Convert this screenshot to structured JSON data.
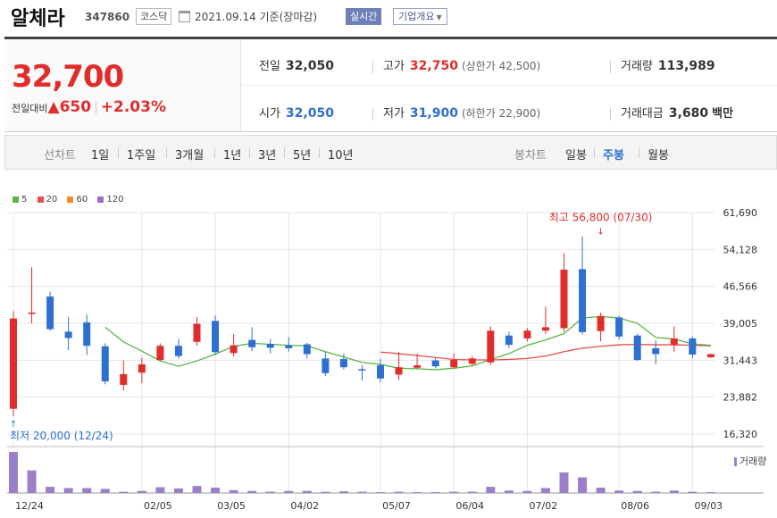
{
  "header": {
    "name": "알체라",
    "code": "347860",
    "market": "코스닥",
    "date": "2021.09.14 기준(장마감)",
    "realtime_label": "실시간",
    "company_label": "기업개요"
  },
  "price": {
    "current": "32,700",
    "change_label": "전일대비",
    "change_value": "650",
    "change_pct": "+2.03%"
  },
  "stats": {
    "prev_label": "전일",
    "prev": "32,050",
    "high_label": "고가",
    "high": "32,750",
    "upper_limit": "(상한가 42,500)",
    "volume_label": "거래량",
    "volume": "113,989",
    "open_label": "시가",
    "open": "32,050",
    "low_label": "저가",
    "low": "31,900",
    "lower_limit": "(하한가 22,900)",
    "amount_label": "거래대금",
    "amount": "3,680",
    "amount_unit": "백만"
  },
  "periods": {
    "line_label": "선차트",
    "line_items": [
      "1일",
      "1주일",
      "3개월",
      "1년",
      "3년",
      "5년",
      "10년"
    ],
    "candle_label": "봉차트",
    "candle_items": [
      "일봉",
      "주봉",
      "월봉"
    ],
    "active_candle": "주봉"
  },
  "colors": {
    "up": "#e12c2c",
    "down": "#2e6fd1",
    "ma5": "#5bb447",
    "ma20": "#e84c4c",
    "ma60": "#f28b30",
    "ma120": "#9b6fcf",
    "volume": "#9b7fc8"
  },
  "chart_data": {
    "type": "candlestick",
    "legend": [
      {
        "name": "5",
        "color": "#5bb447"
      },
      {
        "name": "20",
        "color": "#e84c4c"
      },
      {
        "name": "60",
        "color": "#f28b30"
      },
      {
        "name": "120",
        "color": "#9b6fcf"
      }
    ],
    "y_ticks": [
      "61,690",
      "54,128",
      "46,566",
      "39,005",
      "31,443",
      "23,882",
      "16,320"
    ],
    "ylim": [
      16320,
      61690
    ],
    "x_ticks": [
      {
        "label": "12/24",
        "index": 0
      },
      {
        "label": "02/05",
        "index": 7
      },
      {
        "label": "03/05",
        "index": 11
      },
      {
        "label": "04/02",
        "index": 15
      },
      {
        "label": "05/07",
        "index": 20
      },
      {
        "label": "06/04",
        "index": 24
      },
      {
        "label": "07/02",
        "index": 28
      },
      {
        "label": "08/06",
        "index": 33
      },
      {
        "label": "09/03",
        "index": 37
      }
    ],
    "annotations": {
      "high": "최고 56,800 (07/30)",
      "high_value": 56800,
      "high_index": 32,
      "low": "최저 20,000 (12/24)",
      "low_value": 20000,
      "low_index": 0
    },
    "volume_label": "거래량",
    "candles": [
      {
        "o": 21500,
        "h": 41500,
        "l": 20000,
        "c": 40000
      },
      {
        "o": 41000,
        "h": 50500,
        "l": 39000,
        "c": 41200
      },
      {
        "o": 44500,
        "h": 45500,
        "l": 37500,
        "c": 37800
      },
      {
        "o": 37300,
        "h": 40300,
        "l": 33500,
        "c": 36000
      },
      {
        "o": 39200,
        "h": 40800,
        "l": 32500,
        "c": 34400
      },
      {
        "o": 34300,
        "h": 34900,
        "l": 26500,
        "c": 27100
      },
      {
        "o": 26400,
        "h": 31400,
        "l": 25200,
        "c": 28600
      },
      {
        "o": 28900,
        "h": 31900,
        "l": 26700,
        "c": 30600
      },
      {
        "o": 31500,
        "h": 34900,
        "l": 31300,
        "c": 34400
      },
      {
        "o": 34400,
        "h": 35800,
        "l": 31800,
        "c": 32300
      },
      {
        "o": 35200,
        "h": 40300,
        "l": 34400,
        "c": 38900
      },
      {
        "o": 39500,
        "h": 40600,
        "l": 32500,
        "c": 33100
      },
      {
        "o": 32900,
        "h": 36800,
        "l": 32200,
        "c": 34500
      },
      {
        "o": 35600,
        "h": 38200,
        "l": 33300,
        "c": 34100
      },
      {
        "o": 34800,
        "h": 35800,
        "l": 32900,
        "c": 34000
      },
      {
        "o": 34500,
        "h": 36200,
        "l": 33200,
        "c": 33900
      },
      {
        "o": 34700,
        "h": 35000,
        "l": 31800,
        "c": 32700
      },
      {
        "o": 31800,
        "h": 33200,
        "l": 28200,
        "c": 28800
      },
      {
        "o": 31700,
        "h": 32800,
        "l": 29600,
        "c": 30000
      },
      {
        "o": 29600,
        "h": 30400,
        "l": 27300,
        "c": 29400
      },
      {
        "o": 30400,
        "h": 31700,
        "l": 26900,
        "c": 27700
      },
      {
        "o": 28500,
        "h": 33100,
        "l": 27400,
        "c": 30000
      },
      {
        "o": 29900,
        "h": 32800,
        "l": 29700,
        "c": 30400
      },
      {
        "o": 31400,
        "h": 31900,
        "l": 29800,
        "c": 30200
      },
      {
        "o": 30000,
        "h": 32800,
        "l": 29700,
        "c": 31500
      },
      {
        "o": 30700,
        "h": 32300,
        "l": 30300,
        "c": 31800
      },
      {
        "o": 31000,
        "h": 38400,
        "l": 30500,
        "c": 37500
      },
      {
        "o": 36500,
        "h": 37300,
        "l": 33900,
        "c": 34600
      },
      {
        "o": 35900,
        "h": 38000,
        "l": 35300,
        "c": 37500
      },
      {
        "o": 37500,
        "h": 42400,
        "l": 36800,
        "c": 38200
      },
      {
        "o": 38000,
        "h": 53400,
        "l": 37300,
        "c": 50000
      },
      {
        "o": 50100,
        "h": 56800,
        "l": 36700,
        "c": 37200
      },
      {
        "o": 37400,
        "h": 41200,
        "l": 35300,
        "c": 40500
      },
      {
        "o": 40200,
        "h": 40600,
        "l": 35700,
        "c": 36300
      },
      {
        "o": 36500,
        "h": 36900,
        "l": 31300,
        "c": 31500
      },
      {
        "o": 33900,
        "h": 35500,
        "l": 30600,
        "c": 32700
      },
      {
        "o": 34600,
        "h": 38400,
        "l": 33200,
        "c": 35900
      },
      {
        "o": 35900,
        "h": 36300,
        "l": 31800,
        "c": 32600
      },
      {
        "o": 32050,
        "h": 32750,
        "l": 31900,
        "c": 32700
      }
    ],
    "ma5": [
      null,
      null,
      null,
      null,
      null,
      38200,
      35200,
      33300,
      31300,
      30200,
      31300,
      32700,
      34300,
      34900,
      34700,
      34500,
      34400,
      33200,
      32100,
      31000,
      30600,
      29800,
      29700,
      29500,
      29800,
      30300,
      31600,
      32800,
      34500,
      35600,
      36900,
      40100,
      40400,
      40100,
      39000,
      36100,
      35800,
      34800,
      34500
    ],
    "ma20": [
      null,
      null,
      null,
      null,
      null,
      null,
      null,
      null,
      null,
      null,
      null,
      null,
      null,
      null,
      null,
      null,
      null,
      null,
      null,
      null,
      33100,
      32800,
      32400,
      32000,
      31600,
      31500,
      31500,
      31600,
      31800,
      32300,
      33200,
      33900,
      34300,
      34600,
      34700,
      34600,
      34600,
      34500,
      34400
    ],
    "volumes": [
      100,
      55,
      15,
      12,
      12,
      10,
      3,
      5,
      14,
      11,
      17,
      13,
      7,
      5,
      3,
      5,
      5,
      3,
      4,
      3,
      2,
      3,
      2,
      2,
      3,
      3,
      15,
      6,
      5,
      12,
      50,
      38,
      13,
      6,
      5,
      3,
      6,
      3,
      2
    ]
  }
}
